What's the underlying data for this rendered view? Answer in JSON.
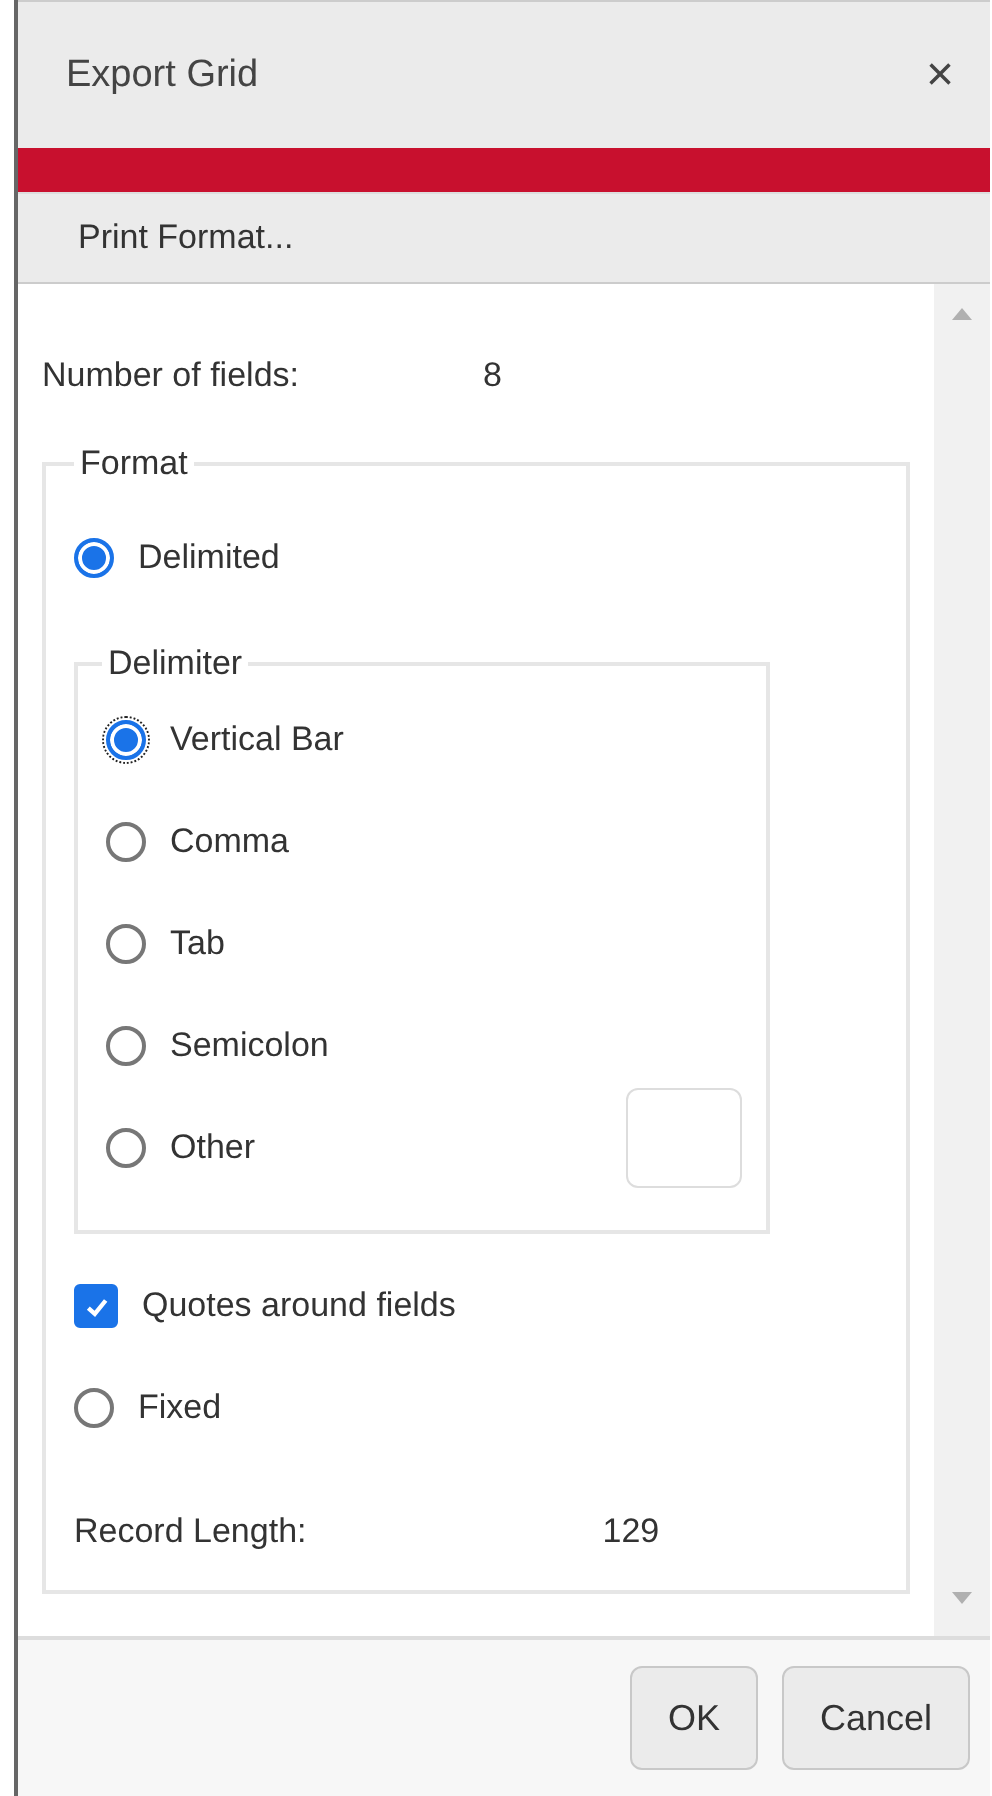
{
  "window": {
    "title": "Export Grid",
    "close": "×"
  },
  "menu": {
    "label": "Print Format..."
  },
  "number_of_fields": {
    "label": "Number of fields:",
    "value": "8"
  },
  "format": {
    "legend": "Format",
    "delimited": {
      "label": "Delimited",
      "selected": true
    },
    "delimiter": {
      "legend": "Delimiter",
      "options": [
        {
          "label": "Vertical Bar",
          "selected": true,
          "focused": true
        },
        {
          "label": "Comma",
          "selected": false,
          "focused": false
        },
        {
          "label": "Tab",
          "selected": false,
          "focused": false
        },
        {
          "label": "Semicolon",
          "selected": false,
          "focused": false
        },
        {
          "label": "Other",
          "selected": false,
          "focused": false,
          "kind": "with-input"
        }
      ]
    },
    "quotes": {
      "label": "Quotes around fields",
      "checked": true
    },
    "fixed": {
      "label": "Fixed",
      "selected": false
    },
    "record_length": {
      "label": "Record Length:",
      "value": "129"
    }
  },
  "buttons": [
    {
      "label": "OK"
    },
    {
      "label": "Cancel"
    }
  ]
}
